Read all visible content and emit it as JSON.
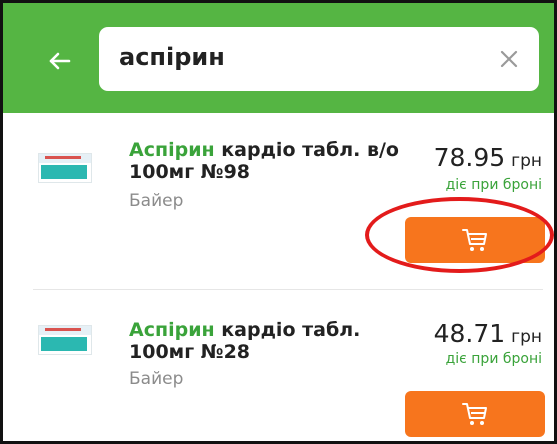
{
  "search": {
    "query": "аспірин"
  },
  "icons": {
    "back": "arrow-left-icon",
    "clear": "close-icon",
    "cart": "cart-icon"
  },
  "colors": {
    "header": "#55b543",
    "accent": "#f7751d",
    "highlight": "#3aa33a",
    "annotation": "#e31b1b"
  },
  "products": [
    {
      "name_highlight": "Аспірин",
      "name_rest": " кардіо табл. в/о 100мг №98",
      "manufacturer": "Байер",
      "price": "78.95",
      "currency": "грн",
      "note": "діє при броні"
    },
    {
      "name_highlight": "Аспірин",
      "name_rest": " кардіо табл. 100мг №28",
      "manufacturer": "Байер",
      "price": "48.71",
      "currency": "грн",
      "note": "діє при броні"
    }
  ]
}
